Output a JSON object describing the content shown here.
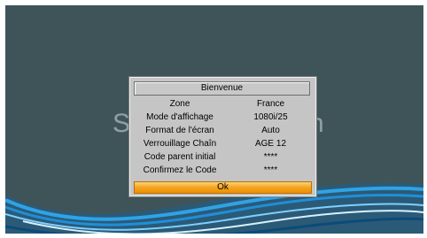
{
  "background": {
    "left_text": "S",
    "right_text": "n"
  },
  "dialog": {
    "title": "Bienvenue",
    "rows": [
      {
        "label": "Zone",
        "value": "France"
      },
      {
        "label": "Mode d'affichage",
        "value": "1080i/25"
      },
      {
        "label": "Format de l'écran",
        "value": "Auto"
      },
      {
        "label": "Verrouillage Chaîn",
        "value": "AGE 12"
      },
      {
        "label": "Code parent initial",
        "value": "****"
      },
      {
        "label": "Confirmez le Code",
        "value": "****"
      }
    ],
    "ok_label": "Ok"
  },
  "colors": {
    "screen_bg": "#3f5459",
    "dialog_bg": "#c5c5c5",
    "ok_highlight": "#f5a623",
    "wave_blue": "#1f8fd8"
  }
}
